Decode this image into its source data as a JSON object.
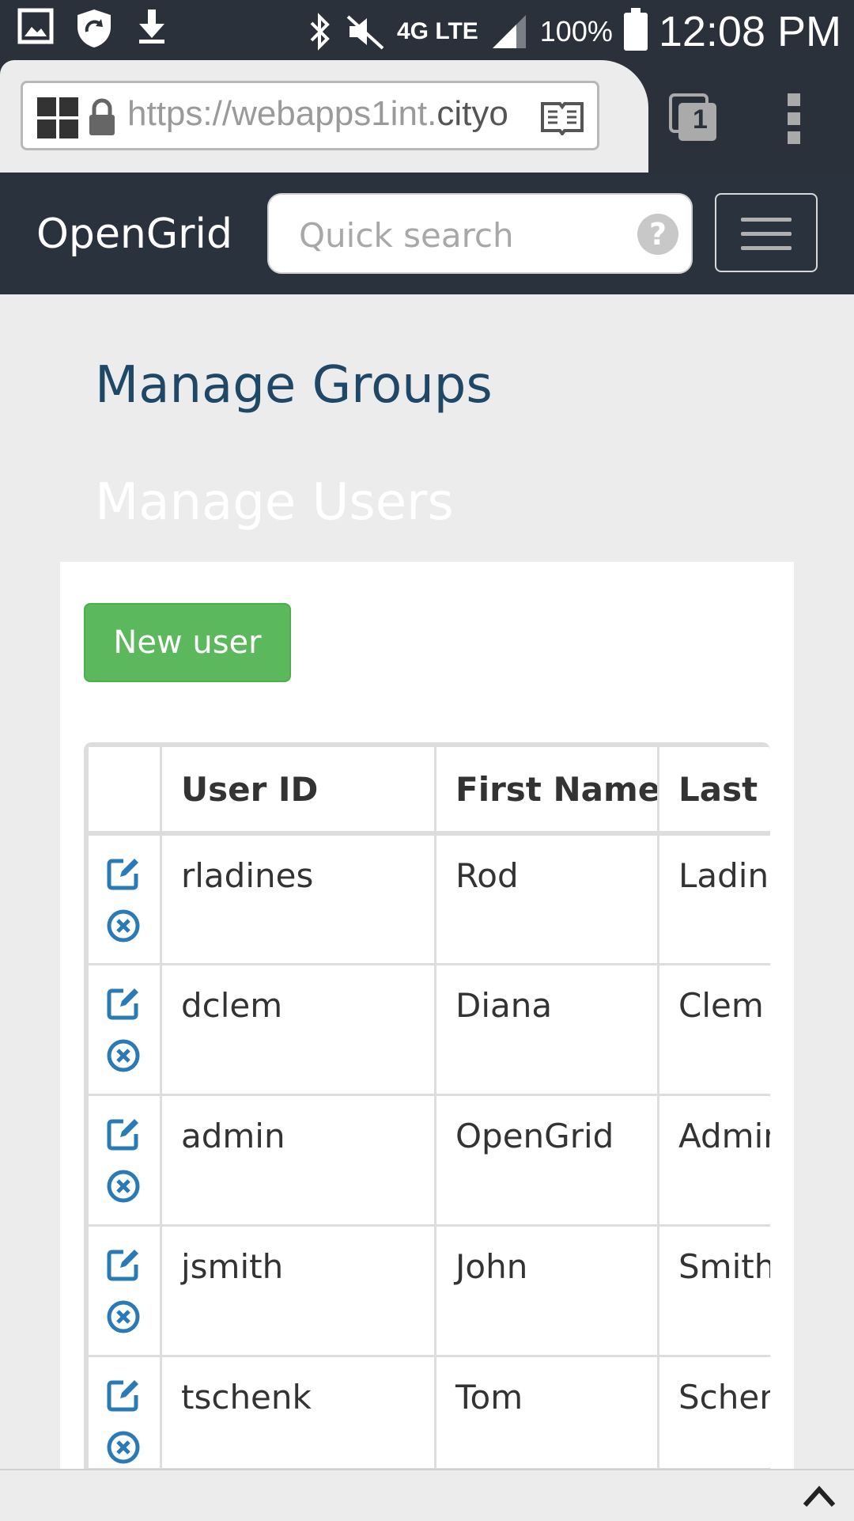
{
  "status_bar": {
    "battery": "100%",
    "time": "12:08 PM",
    "network": "4G LTE"
  },
  "browser": {
    "url_prefix": "https://webapps1int.",
    "url_domain": "cityo",
    "tab_count": "1"
  },
  "navbar": {
    "brand": "OpenGrid",
    "search_placeholder": "Quick search",
    "help_glyph": "?"
  },
  "headings": {
    "groups": "Manage Groups",
    "users": "Manage Users"
  },
  "panel": {
    "new_user_label": "New user"
  },
  "table": {
    "headers": [
      "",
      "User ID",
      "First Name",
      "Last Name"
    ],
    "rows": [
      {
        "user_id": "rladines",
        "first_name": "Rod",
        "last_name": "Ladines"
      },
      {
        "user_id": "dclem",
        "first_name": "Diana",
        "last_name": "Clem"
      },
      {
        "user_id": "admin",
        "first_name": "OpenGrid",
        "last_name": "Admin"
      },
      {
        "user_id": "jsmith",
        "first_name": "John",
        "last_name": "Smith"
      },
      {
        "user_id": "tschenk",
        "first_name": "Tom",
        "last_name": "Schenk"
      }
    ]
  },
  "colors": {
    "navbar_bg": "#2a323d",
    "heading_blue": "#1f4866",
    "success_green": "#5cb85c",
    "action_blue": "#2a7ab8"
  }
}
